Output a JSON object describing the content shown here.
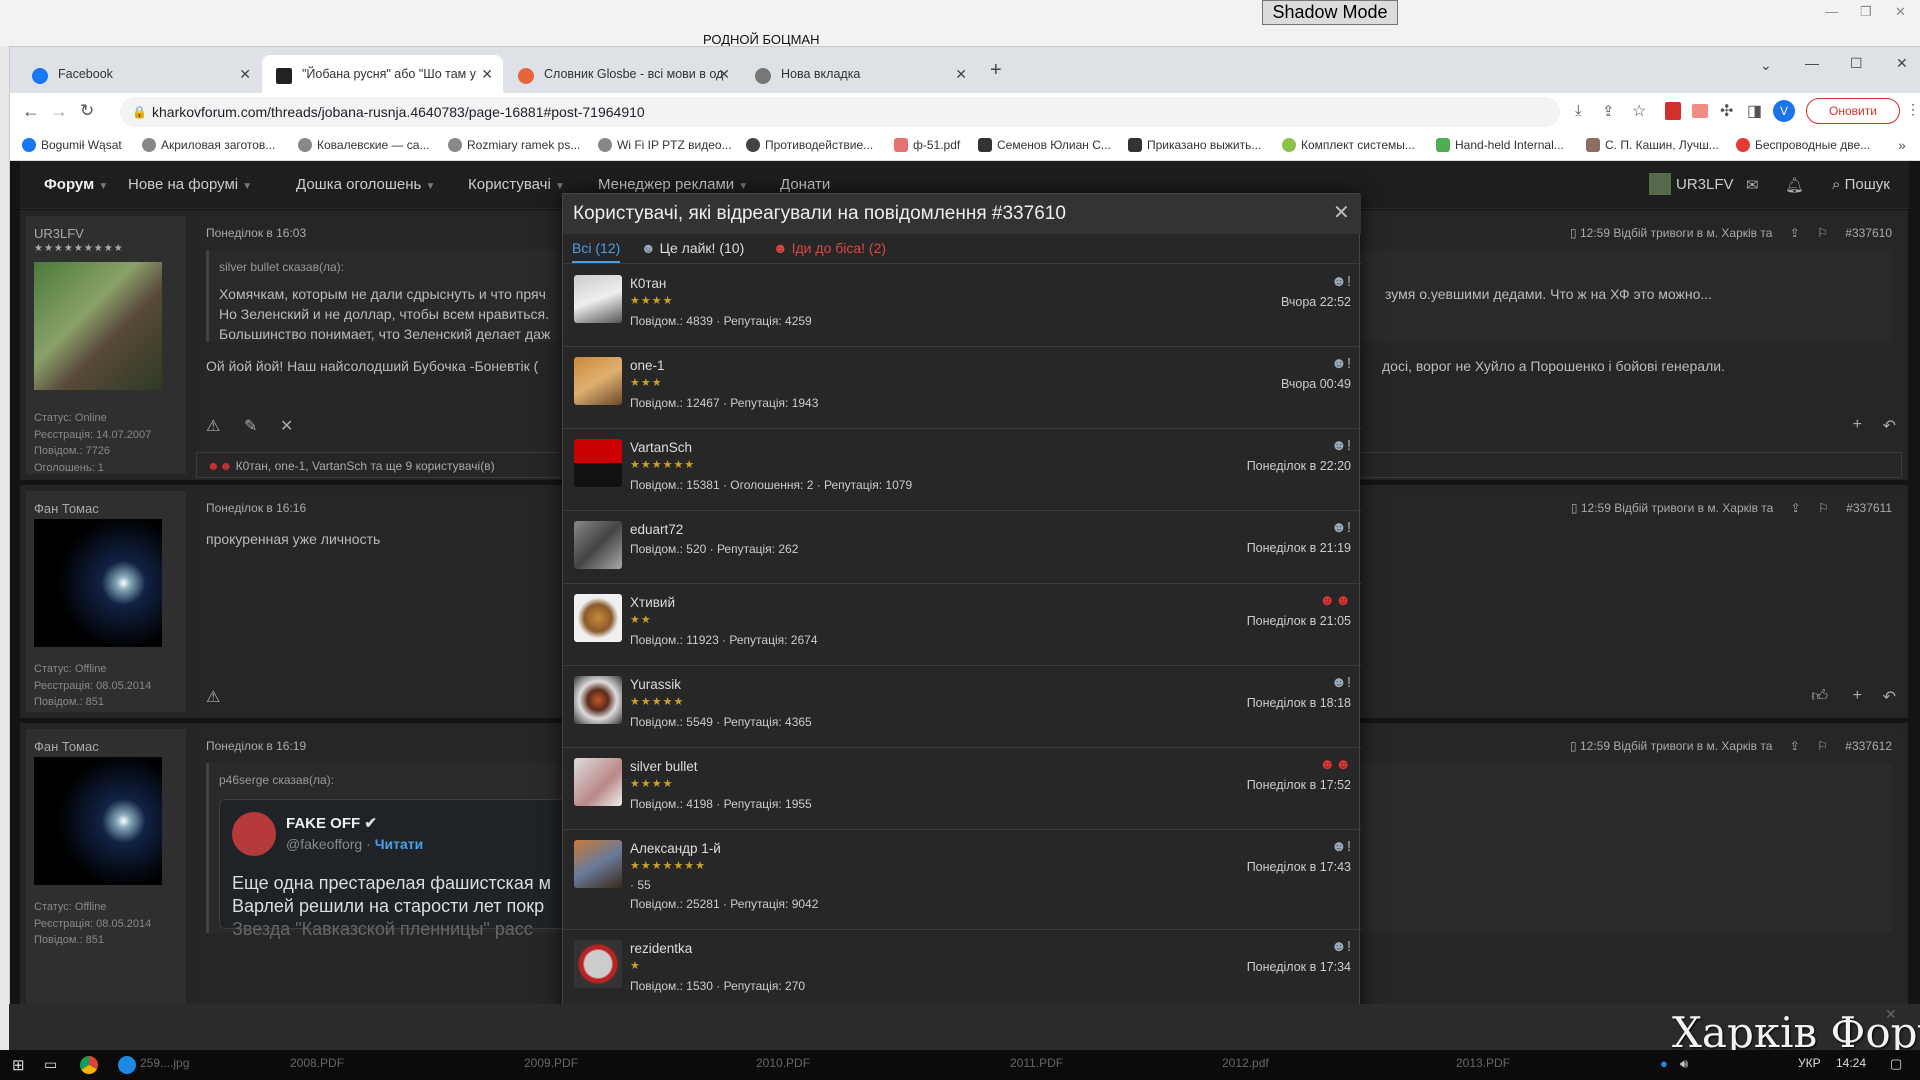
{
  "top": {
    "shadow_mode": "Shadow Mode",
    "behind_title": "РОДНОЙ БОЦМАН"
  },
  "browser": {
    "tabs": [
      {
        "label": "Facebook",
        "color": "#1877f2"
      },
      {
        "label": "\"Йобана русня\" або \"Шо там у",
        "color": "#222222"
      },
      {
        "label": "Словник Glosbe - всі мови в од",
        "color": "#e8643c"
      },
      {
        "label": "Нова вкладка",
        "color": "#777777"
      }
    ],
    "url": "kharkovforum.com/threads/jobana-rusnja.4640783/page-16881#post-71964910",
    "update_button": "Оновити",
    "profile_letter": "V",
    "bookmarks": [
      "Bogumił Wąsat",
      "Акриловая заготов...",
      "Ковалевские — са...",
      "Rozmiary ramek ps...",
      "Wi Fi IP PTZ видео...",
      "Противодействие...",
      "ф-51.pdf",
      "Семенов Юлиан С...",
      "Приказано выжить...",
      "Комплект системы...",
      "Hand-held Internal...",
      "С. П. Кашин, Лучш...",
      "Беспроводные две..."
    ]
  },
  "forum": {
    "nav": [
      "Форум",
      "Нове на форумі",
      "Дошка оголошень",
      "Користувачі",
      "Менеджер реклами",
      "Донати"
    ],
    "user": "UR3LFV",
    "search": "Пошук",
    "posts": [
      {
        "author": "UR3LFV",
        "stars": "★★★★★★★★★",
        "status": "Статус: Online",
        "registered": "Реєстрація: 14.07.2007",
        "messages": "Повідом.: 7726",
        "ads": "Оголошень: 1",
        "date": "Понеділок в 16:03",
        "quote_author": "silver bullet сказав(ла):",
        "quote_lines": [
          "Хомячкам, которым не дали сдрыснуть и что пряч",
          "Но Зеленский и не доллар, чтобы всем нравиться.",
          "Большинство понимает, что Зеленский делает даж"
        ],
        "quote_right": "зумя о.уевшими дедами. Что ж на ХФ это можно...",
        "text": "Ой йой йой! Наш найсолодший Бубочка -Боневтік (",
        "text_right": "досі, ворог не Хуйло а Порошенко і бойові генерали.",
        "alert": "12:59 Відбій тривоги в м. Харків та",
        "number": "#337610",
        "reactions": "К0тан, one-1, VartanSch та ще 9 користувачі(в)"
      },
      {
        "author": "Фан Томас",
        "status": "Статус: Offline",
        "registered": "Реєстрація: 08.05.2014",
        "messages": "Повідом.: 851",
        "date": "Понеділок в 16:16",
        "text": "прокуренная уже личность",
        "alert": "12:59 Відбій тривоги в м. Харків та",
        "number": "#337611"
      },
      {
        "author": "Фан Томас",
        "status": "Статус: Offline",
        "registered": "Реєстрація: 08.05.2014",
        "messages": "Повідом.: 851",
        "date": "Понеділок в 16:19",
        "quote_author": "p46serge сказав(ла):",
        "embed_name": "FAKE OFF",
        "embed_handle": "@fakeofforg",
        "embed_read": "Читати",
        "embed_lines": [
          "Еще одна престарелая фашистская м",
          "Варлей решили на старости лет покр",
          "Звезда \"Кавказской пленницы\" расс"
        ],
        "alert": "12:59 Відбій тривоги в м. Харків та",
        "number": "#337612"
      }
    ]
  },
  "modal": {
    "title": "Користувачі, які відреагували на повідомлення #337610",
    "tabs": {
      "all": "Всі (12)",
      "like": "Це лайк! (10)",
      "devil": "Іди до біса! (2)"
    },
    "rows": [
      {
        "name": "К0тан",
        "stars": "★★★★",
        "stats": "Повідом.: 4839 · Репутація: 4259",
        "date": "Вчора 22:52",
        "reaction": "like"
      },
      {
        "name": "one-1",
        "stars": "★★★",
        "stats": "Повідом.: 12467 · Репутація: 1943",
        "date": "Вчора 00:49",
        "reaction": "like"
      },
      {
        "name": "VartanSch",
        "stars": "★★★★★★",
        "stats": "Повідом.: 15381 · Оголошення: 2 · Репутація: 1079",
        "date": "Понеділок в 22:20",
        "reaction": "like"
      },
      {
        "name": "eduart72",
        "stars": "",
        "stats": "Повідом.: 520 · Репутація: 262",
        "date": "Понеділок в 21:19",
        "reaction": "like"
      },
      {
        "name": "Хтивий",
        "stars": "★★",
        "stats": "Повідом.: 11923 · Репутація: 2674",
        "date": "Понеділок в 21:05",
        "reaction": "devil"
      },
      {
        "name": "Yurassik",
        "stars": "★★★★★",
        "stats": "Повідом.: 5549 · Репутація: 4365",
        "date": "Понеділок в 18:18",
        "reaction": "like"
      },
      {
        "name": "silver bullet",
        "stars": "★★★★",
        "stats": "Повідом.: 4198 · Репутація: 1955",
        "date": "Понеділок в 17:52",
        "reaction": "devil"
      },
      {
        "name": "Александр 1-й",
        "stars": "★★★★★★★",
        "extra": "· 55",
        "stats": "Повідом.: 25281 · Репутація: 9042",
        "date": "Понеділок в 17:43",
        "reaction": "like"
      },
      {
        "name": "rezidentka",
        "stars": "★",
        "stats": "Повідом.: 1530 · Репутація: 270",
        "date": "Понеділок в 17:34",
        "reaction": "like"
      }
    ]
  },
  "taskbar": {
    "files": [
      "259....jpg",
      "2008.PDF",
      "2009.PDF",
      "2010.PDF",
      "2011.PDF",
      "2012.pdf",
      "2013.PDF"
    ],
    "lang": "УКР",
    "time": "14:24"
  },
  "watermark": "Харків Форум"
}
